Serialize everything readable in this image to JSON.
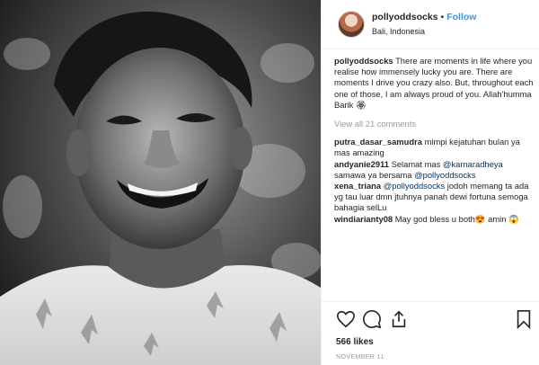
{
  "header": {
    "username": "pollyoddsocks",
    "separator": "•",
    "follow_label": "Follow",
    "location": "Bali, Indonesia"
  },
  "caption": {
    "username": "pollyoddsocks",
    "text": "There are moments in life where you realise how immensely lucky you are. There are moments I drive you crazy also. But, throughout each one of those, I am always proud of you. Allah'humma Barik 🏵"
  },
  "view_all": "View all 21 comments",
  "comments": [
    {
      "username": "putra_dasar_samudra",
      "pre": "mimpi kejatuhan bulan ya mas amazing",
      "mention": "",
      "post": ""
    },
    {
      "username": "andyanie2911",
      "pre": "Selamat mas ",
      "mention": "@karnaradheya",
      "post": " samawa ya bersama ",
      "mention2": "@pollyoddsocks"
    },
    {
      "username": "xena_triana",
      "pre": "",
      "mention": "@pollyoddsocks",
      "post": " jodoh memang ta ada yg tau luar dmn jtuhnya panah dewi fortuna semoga bahagia selLu"
    },
    {
      "username": "windiarianty08",
      "pre": "May god bless u both😍 amin 😱",
      "mention": "",
      "post": ""
    }
  ],
  "actions": {
    "like_icon": "heart-icon",
    "comment_icon": "comment-icon",
    "share_icon": "share-icon",
    "save_icon": "bookmark-icon"
  },
  "likes": "566 likes",
  "date": "NOVEMBER 11",
  "colors": {
    "accent": "#3897f0",
    "text": "#262626",
    "muted": "#999999"
  }
}
